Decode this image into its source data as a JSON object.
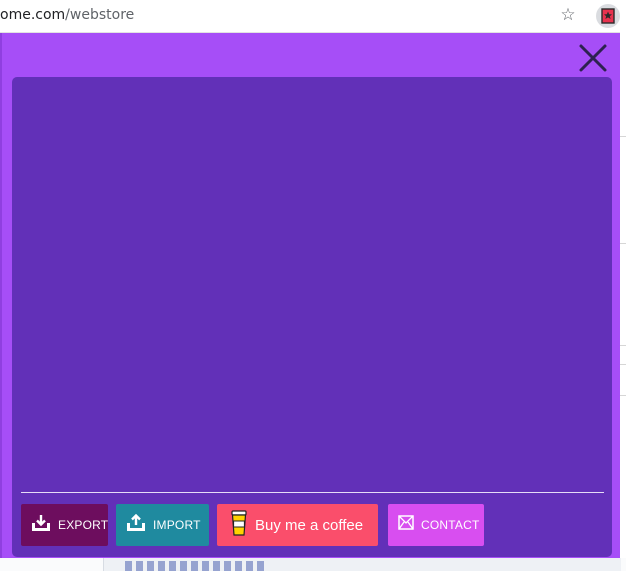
{
  "browser": {
    "url_host": "ome.com",
    "url_path": "/webstore"
  },
  "icons": {
    "star": "star-outline-icon",
    "extension": "bookmark-extension-icon",
    "close": "close-x-icon",
    "export": "download-tray-icon",
    "import": "upload-tray-icon",
    "coffee": "coffee-cup-icon",
    "contact": "envelope-icon"
  },
  "colors": {
    "popup_bg": "#a64ef7",
    "panel_bg": "#6230b8",
    "export_bg": "#6d0d5e",
    "import_bg": "#1f8a9f",
    "coffee_bg": "#fa4e6b",
    "contact_bg": "#d84ef0"
  },
  "footer": {
    "export_label": "EXPORT",
    "import_label": "IMPORT",
    "coffee_label": "Buy me a coffee",
    "contact_label": "CONTACT"
  }
}
